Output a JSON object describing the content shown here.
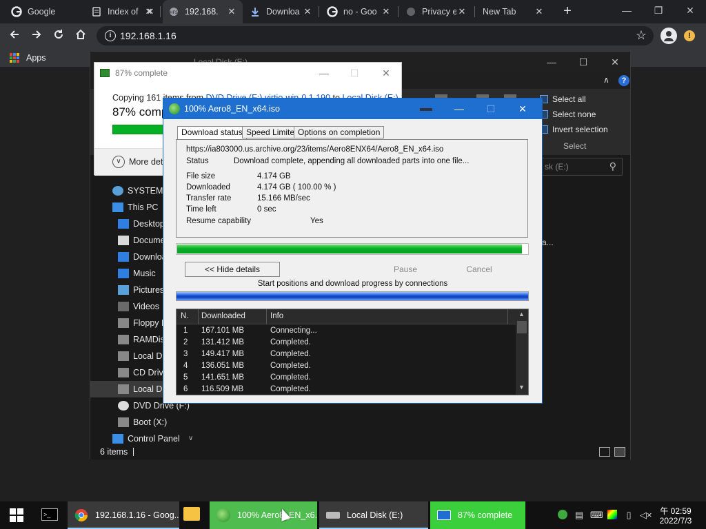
{
  "browser": {
    "tabs": [
      {
        "label": "Google",
        "icon": "google-icon"
      },
      {
        "label": "Index of",
        "icon": "server-icon"
      },
      {
        "label": "192.168.",
        "icon": "hfs-icon",
        "active": true
      },
      {
        "label": "Downloa",
        "icon": "download-icon"
      },
      {
        "label": "no - Goo",
        "icon": "google-icon"
      },
      {
        "label": "Privacy e",
        "icon": "globe-icon"
      },
      {
        "label": "New Tab",
        "icon": ""
      }
    ],
    "address": "192.168.1.16",
    "bookmarks_apps_label": "Apps",
    "update_badge": "!"
  },
  "explorer": {
    "title": "Local Disk (E:)",
    "select_items": [
      "Select all",
      "Select none",
      "Invert selection"
    ],
    "select_group_label": "Select",
    "search_placeholder": "sk (E:)",
    "content_text": "a...",
    "nav_items": [
      {
        "label": "SYSTEM",
        "icon": "user-icon",
        "color": "#5aa0d8"
      },
      {
        "label": "This PC",
        "icon": "computer-icon",
        "color": "#3a8ee6"
      },
      {
        "label": "Desktop",
        "icon": "desktop-icon",
        "color": "#2f7fe0"
      },
      {
        "label": "Docume",
        "icon": "documents-icon",
        "color": "#d8d8d8"
      },
      {
        "label": "Downloa",
        "icon": "downloads-icon",
        "color": "#2f7fe0"
      },
      {
        "label": "Music",
        "icon": "music-icon",
        "color": "#2f7fe0"
      },
      {
        "label": "Pictures",
        "icon": "pictures-icon",
        "color": "#5aa0d8"
      },
      {
        "label": "Videos",
        "icon": "videos-icon",
        "color": "#6a6a6a"
      },
      {
        "label": "Floppy D",
        "icon": "floppy-icon",
        "color": "#888"
      },
      {
        "label": "RAMDisk",
        "icon": "drive-icon",
        "color": "#888"
      },
      {
        "label": "Local Dis",
        "icon": "drive-icon",
        "color": "#888"
      },
      {
        "label": "CD Drive",
        "icon": "cd-drive-icon",
        "color": "#888"
      },
      {
        "label": "Local Dis",
        "icon": "drive-icon",
        "color": "#888",
        "selected": true
      },
      {
        "label": "DVD Drive (F:)",
        "icon": "dvd-icon",
        "color": "#ddd"
      },
      {
        "label": "Boot (X:)",
        "icon": "drive-icon",
        "color": "#888"
      },
      {
        "label": "Control Panel",
        "icon": "control-panel-icon",
        "color": "#3a8ee6"
      }
    ],
    "status_items": "6 items"
  },
  "copy_dialog": {
    "title": "87% complete",
    "line1_prefix": "Copying 161 items from ",
    "line1_source": "DVD Drive (F:) virtio-win-0.1.190",
    "line1_mid": " to ",
    "line1_dest": "Local Disk (E:)",
    "percent_text": "87% comp",
    "progress": 0.87,
    "more_details": "More deta"
  },
  "idm": {
    "title": "100% Aero8_EN_x64.iso",
    "tabs": [
      "Download status",
      "Speed Limiter",
      "Options on completion"
    ],
    "url": "https://ia803000.us.archive.org/23/items/Aero8ENX64/Aero8_EN_x64.iso",
    "status_label": "Status",
    "status_value": "Download complete, appending all downloaded parts into one file...",
    "rows": [
      {
        "label": "File size",
        "value": "4.174  GB"
      },
      {
        "label": "Downloaded",
        "value": "4.174  GB  ( 100.00 % )"
      },
      {
        "label": "Transfer rate",
        "value": "15.166  MB/sec"
      },
      {
        "label": "Time left",
        "value": "0 sec"
      }
    ],
    "resume_label": "Resume capability",
    "resume_value": "Yes",
    "progress": 0.985,
    "hide_details": "<< Hide details",
    "pause": "Pause",
    "cancel": "Cancel",
    "connections_label": "Start positions and download progress by connections",
    "list_headers": [
      "N.",
      "Downloaded",
      "Info"
    ],
    "connections": [
      {
        "n": "1",
        "downloaded": "167.101  MB",
        "info": "Connecting..."
      },
      {
        "n": "2",
        "downloaded": "131.412  MB",
        "info": "Completed."
      },
      {
        "n": "3",
        "downloaded": "149.417  MB",
        "info": "Completed."
      },
      {
        "n": "4",
        "downloaded": "136.051  MB",
        "info": "Completed."
      },
      {
        "n": "5",
        "downloaded": "141.651  MB",
        "info": "Completed."
      },
      {
        "n": "6",
        "downloaded": "116.509  MB",
        "info": "Completed."
      }
    ]
  },
  "taskbar": {
    "apps": [
      {
        "label": "192.168.1.16 - Goog...",
        "icon": "chrome-icon"
      },
      {
        "label": "100% Aero8_EN_x6...",
        "icon": "idm-icon"
      },
      {
        "label": "Local Disk (E:)",
        "icon": "drive-icon"
      },
      {
        "label": "87% complete",
        "icon": "copy-icon"
      }
    ],
    "clock_time": "午 02:59",
    "clock_date": "2022/7/3"
  }
}
